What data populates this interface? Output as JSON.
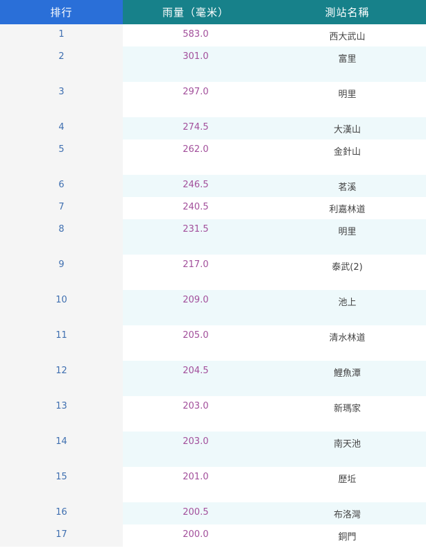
{
  "header": {
    "rank": "排行",
    "rain": "雨量（毫米）",
    "station": "測站名稱"
  },
  "colors": {
    "rank_header": "#2a6fd8",
    "header": "#17818a",
    "rank_text": "#3f6fb0",
    "rain_text": "#a24f9b",
    "row_alt_background": "#eef9fb",
    "rank_column_background": "#f5f5f5"
  },
  "rows": [
    {
      "rank": "1",
      "rain": "583.0",
      "station": "西大武山"
    },
    {
      "rank": "2",
      "rain": "301.0",
      "station": "富里"
    },
    {
      "rank": "3",
      "rain": "297.0",
      "station": "明里"
    },
    {
      "rank": "4",
      "rain": "274.5",
      "station": "大漢山"
    },
    {
      "rank": "5",
      "rain": "262.0",
      "station": "金針山"
    },
    {
      "rank": "6",
      "rain": "246.5",
      "station": "茗溪"
    },
    {
      "rank": "7",
      "rain": "240.5",
      "station": "利嘉林道"
    },
    {
      "rank": "8",
      "rain": "231.5",
      "station": "明里"
    },
    {
      "rank": "9",
      "rain": "217.0",
      "station": "泰武(2)"
    },
    {
      "rank": "10",
      "rain": "209.0",
      "station": "池上"
    },
    {
      "rank": "11",
      "rain": "205.0",
      "station": "清水林道"
    },
    {
      "rank": "12",
      "rain": "204.5",
      "station": "鯉魚潭"
    },
    {
      "rank": "13",
      "rain": "203.0",
      "station": "新瑪家"
    },
    {
      "rank": "14",
      "rain": "203.0",
      "station": "南天池"
    },
    {
      "rank": "15",
      "rain": "201.0",
      "station": "歷坵"
    },
    {
      "rank": "16",
      "rain": "200.5",
      "station": "布洛灣"
    },
    {
      "rank": "17",
      "rain": "200.0",
      "station": "銅門"
    }
  ]
}
